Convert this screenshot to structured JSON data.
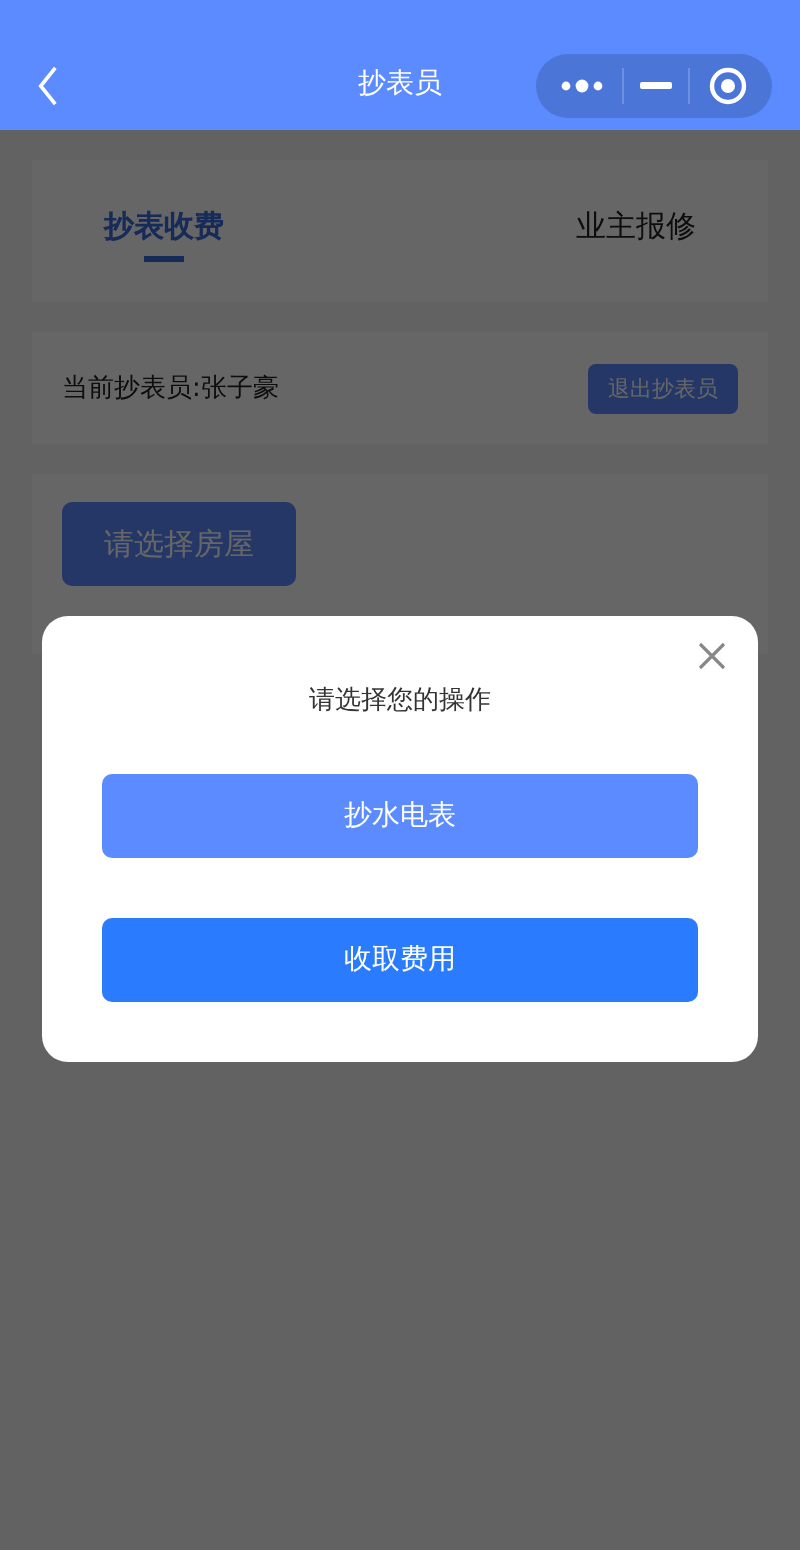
{
  "nav": {
    "title": "抄表员"
  },
  "tabs": [
    {
      "label": "抄表收费",
      "selected": true
    },
    {
      "label": "业主报修",
      "selected": false
    }
  ],
  "operator": {
    "label": "当前抄表员:张子豪",
    "button": "退出抄表员"
  },
  "select_button": "请选择房屋",
  "dialog": {
    "title": "请选择您的操作",
    "actions": [
      {
        "label": "抄水电表",
        "kind": "light"
      },
      {
        "label": "收取费用",
        "kind": "primary"
      }
    ]
  }
}
